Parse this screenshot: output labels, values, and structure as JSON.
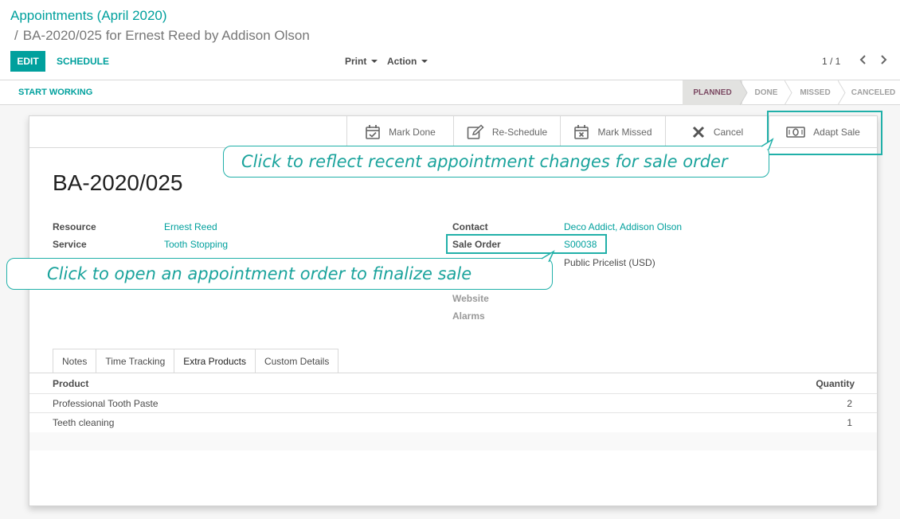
{
  "breadcrumb": {
    "root": "Appointments (April 2020)",
    "separator": "/",
    "current": "BA-2020/025 for Ernest Reed by Addison Olson"
  },
  "toolbar": {
    "edit": "EDIT",
    "schedule": "SCHEDULE",
    "print": "Print",
    "action": "Action",
    "pager": "1 / 1",
    "prev_icon": "chevron-left",
    "next_icon": "chevron-right"
  },
  "statusbar": {
    "start_working": "START WORKING",
    "stages": [
      {
        "label": "PLANNED",
        "active": true
      },
      {
        "label": "DONE",
        "active": false
      },
      {
        "label": "MISSED",
        "active": false
      },
      {
        "label": "CANCELED",
        "active": false
      }
    ]
  },
  "smart_buttons": [
    {
      "label": "Mark Done",
      "icon": "calendar-check-icon"
    },
    {
      "label": "Re-Schedule",
      "icon": "edit-icon"
    },
    {
      "label": "Mark Missed",
      "icon": "calendar-times-icon"
    },
    {
      "label": "Cancel",
      "icon": "close-icon"
    },
    {
      "label": "Adapt Sale",
      "icon": "money-icon"
    }
  ],
  "record": {
    "title": "BA-2020/025",
    "left_fields": [
      {
        "label": "Resource",
        "value": "Ernest Reed"
      },
      {
        "label": "Service",
        "value": "Tooth Stopping"
      }
    ],
    "right_fields": [
      {
        "label": "Contact",
        "value": "Deco Addict, Addison Olson"
      },
      {
        "label": "Sale Order",
        "value": "S00038"
      },
      {
        "label": "",
        "value": "Public Pricelist (USD)"
      },
      {
        "label": "Website",
        "value": ""
      },
      {
        "label": "Alarms",
        "value": ""
      }
    ]
  },
  "tabs": [
    "Notes",
    "Time Tracking",
    "Extra Products",
    "Custom Details"
  ],
  "active_tab": "Extra Products",
  "table": {
    "headers": [
      "Product",
      "Quantity"
    ],
    "rows": [
      {
        "product": "Professional Tooth Paste",
        "quantity": "2"
      },
      {
        "product": "Teeth cleaning",
        "quantity": "1"
      }
    ]
  },
  "tips": {
    "adapt_sale": "Click to reflect recent appointment changes for sale order",
    "sale_order": "Click to open an appointment order to finalize sale"
  },
  "colors": {
    "accent": "#00a09d",
    "tour": "#21b0a9",
    "active_stage": "#7c4a63"
  }
}
